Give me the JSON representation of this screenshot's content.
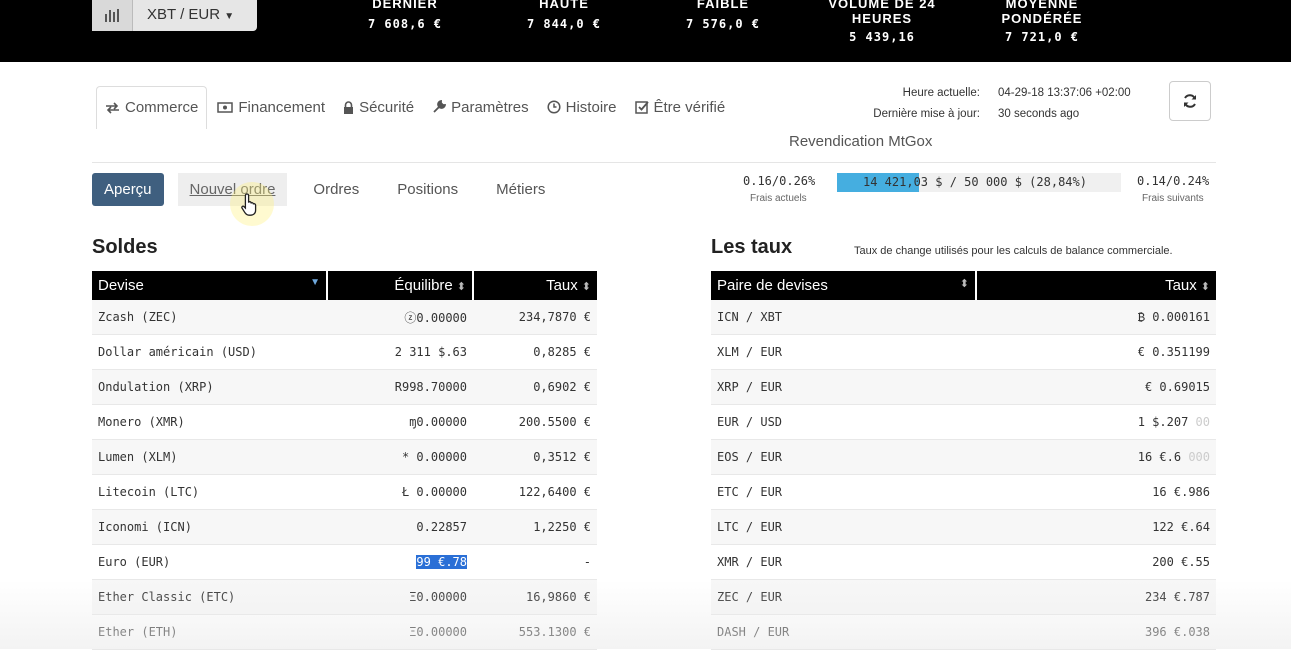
{
  "ticker": {
    "pair": "XBT / EUR",
    "stats": [
      {
        "label": "DERNIER",
        "value": "7 608,6 €"
      },
      {
        "label": "HAUTE",
        "value": "7 844,0 €"
      },
      {
        "label": "FAIBLE",
        "value": "7 576,0 €"
      },
      {
        "label": "VOLUME DE 24 HEURES",
        "value": "5 439,16"
      },
      {
        "label": "MOYENNE PONDÉRÉE",
        "value": "7 721,0 €"
      }
    ]
  },
  "nav": {
    "tabs": [
      {
        "label": "Commerce",
        "icon": "exchange-icon"
      },
      {
        "label": "Financement",
        "icon": "money-icon"
      },
      {
        "label": "Sécurité",
        "icon": "lock-icon"
      },
      {
        "label": "Paramètres",
        "icon": "wrench-icon"
      },
      {
        "label": "Histoire",
        "icon": "clock-icon"
      },
      {
        "label": "Être vérifié",
        "icon": "check-square-icon"
      }
    ],
    "active": "Commerce"
  },
  "time": {
    "current_label": "Heure actuelle:",
    "current_value": "04-29-18 13:37:06 +02:00",
    "updated_label": "Dernière mise à jour:",
    "updated_value": "30 seconds ago"
  },
  "mtgox": "Revendication MtGox",
  "subtabs": [
    "Aperçu",
    "Nouvel ordre",
    "Ordres",
    "Positions",
    "Métiers"
  ],
  "fees": {
    "current": "0.16/0.26%",
    "current_label": "Frais actuels",
    "bar_text": "14 421,03 $ / 50 000 $ (28,84%)",
    "progress": 0.2884,
    "next": "0.14/0.24%",
    "next_label": "Frais suivants"
  },
  "balances": {
    "title": "Soldes",
    "headers": [
      "Devise",
      "Équilibre",
      "Taux"
    ],
    "rows": [
      {
        "currency": "Zcash (ZEC)",
        "balance": "ⓩ0.00000",
        "rate": "234,7870 €"
      },
      {
        "currency": "Dollar américain (USD)",
        "balance": "2 311 $.63",
        "rate": "0,8285 €"
      },
      {
        "currency": "Ondulation (XRP)",
        "balance": "R998.70000",
        "rate": "0,6902 €"
      },
      {
        "currency": "Monero (XMR)",
        "balance": "ɱ0.00000",
        "rate": "200.5500 €"
      },
      {
        "currency": "Lumen (XLM)",
        "balance": "* 0.00000",
        "rate": "0,3512 €"
      },
      {
        "currency": "Litecoin (LTC)",
        "balance": "Ł 0.00000",
        "rate": "122,6400 €"
      },
      {
        "currency": "Iconomi (ICN)",
        "balance": "0.22857",
        "rate": "1,2250 €"
      },
      {
        "currency": "Euro (EUR)",
        "balance": "99 €.78",
        "rate": "-"
      },
      {
        "currency": "Ether Classic (ETC)",
        "balance": "Ξ0.00000",
        "rate": "16,9860 €"
      },
      {
        "currency": "Ether (ETH)",
        "balance": "Ξ0.00000",
        "rate": "553.1300 €"
      }
    ]
  },
  "rates": {
    "title": "Les taux",
    "subtitle": "Taux de change utilisés pour les calculs de balance commerciale.",
    "headers": [
      "Paire de devises",
      "Taux"
    ],
    "rows": [
      {
        "pair": "ICN / XBT",
        "rate": "₿ 0.000161",
        "extra": ""
      },
      {
        "pair": "XLM / EUR",
        "rate": "€ 0.351199",
        "extra": ""
      },
      {
        "pair": "XRP / EUR",
        "rate": "€ 0.69015",
        "extra": ""
      },
      {
        "pair": "EUR / USD",
        "rate": "1 $.207",
        "extra": "00"
      },
      {
        "pair": "EOS / EUR",
        "rate": "16 €.6",
        "extra": "000"
      },
      {
        "pair": "ETC / EUR",
        "rate": "16 €.986",
        "extra": ""
      },
      {
        "pair": "LTC / EUR",
        "rate": "122 €.64",
        "extra": ""
      },
      {
        "pair": "XMR / EUR",
        "rate": "200 €.55",
        "extra": ""
      },
      {
        "pair": "ZEC / EUR",
        "rate": "234 €.787",
        "extra": ""
      },
      {
        "pair": "DASH / EUR",
        "rate": "396 €.038",
        "extra": ""
      }
    ]
  }
}
